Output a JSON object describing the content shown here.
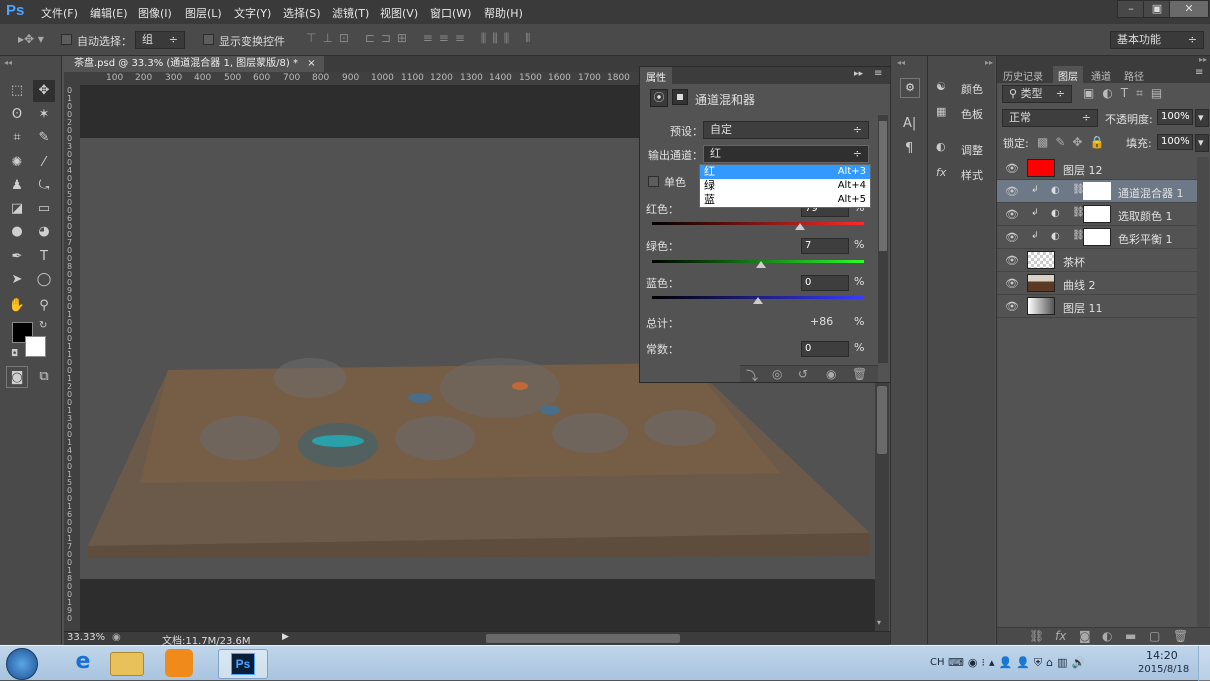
{
  "app": {
    "logo": "Ps"
  },
  "menu": [
    "文件(F)",
    "编辑(E)",
    "图像(I)",
    "图层(L)",
    "文字(Y)",
    "选择(S)",
    "滤镜(T)",
    "视图(V)",
    "窗口(W)",
    "帮助(H)"
  ],
  "window_buttons": {
    "minimize": "–",
    "restore": "▣",
    "close": "✕"
  },
  "options": {
    "auto_select_label": "自动选择：",
    "auto_select_value": "组",
    "show_transform_label": "显示变换控件",
    "workspace": "基本功能"
  },
  "document": {
    "tab_title": "茶盘.psd @ 33.3% (通道混合器 1, 图层蒙版/8) *",
    "close": "×",
    "zoom": "33.33%",
    "doc_size": "文档:11.7M/23.6M"
  },
  "ruler": {
    "top": [
      "100",
      "200",
      "300",
      "400",
      "500",
      "600",
      "700",
      "800",
      "900",
      "1000",
      "1100",
      "1200",
      "1300",
      "1400",
      "1500",
      "1600",
      "1700",
      "1800"
    ],
    "left": [
      "0",
      "1",
      "0",
      "0",
      "2",
      "0",
      "0",
      "3",
      "0",
      "0",
      "4",
      "0",
      "0",
      "5",
      "0",
      "0",
      "6",
      "0",
      "0",
      "7",
      "0",
      "0",
      "8",
      "0",
      "0",
      "9",
      "0",
      "0",
      "1",
      "0",
      "0",
      "0",
      "1",
      "1",
      "0",
      "0",
      "1",
      "2",
      "0",
      "0",
      "1",
      "3",
      "0",
      "0",
      "1",
      "4",
      "0",
      "0",
      "1",
      "5",
      "0",
      "0",
      "1",
      "6",
      "0",
      "0",
      "1",
      "7",
      "0",
      "0",
      "1",
      "8",
      "0",
      "0",
      "1",
      "9",
      "0"
    ]
  },
  "properties": {
    "tab": "属性",
    "title": "通道混和器",
    "preset_label": "预设：",
    "preset_value": "自定",
    "output_label": "输出通道：",
    "output_value": "红",
    "mono_label": "单色",
    "red_label": "红色：",
    "red_value": "79",
    "green_label": "绿色：",
    "green_value": "7",
    "blue_label": "蓝色：",
    "blue_value": "0",
    "total_label": "总计：",
    "total_value": "+86",
    "const_label": "常数：",
    "const_value": "0",
    "pct": "%",
    "dropdown": [
      {
        "label": "红",
        "shortcut": "Alt+3"
      },
      {
        "label": "绿",
        "shortcut": "Alt+4"
      },
      {
        "label": "蓝",
        "shortcut": "Alt+5"
      }
    ]
  },
  "dock": {
    "color": "颜色",
    "swatches": "色板",
    "adjust": "调整",
    "styles": "样式"
  },
  "layers_panel": {
    "tabs": [
      "历史记录",
      "图层",
      "通道",
      "路径"
    ],
    "filter_kind": "类型",
    "blend_mode": "正常",
    "opacity_label": "不透明度:",
    "opacity_value": "100%",
    "lock_label": "锁定:",
    "fill_label": "填充:",
    "fill_value": "100%",
    "layers": [
      {
        "name": "图层 12",
        "thumb": "#ff0000",
        "selected": false,
        "adjust": false
      },
      {
        "name": "通道混合器 1",
        "thumb": "#ffffff",
        "selected": true,
        "adjust": true
      },
      {
        "name": "选取颜色 1",
        "thumb": "#ffffff",
        "selected": false,
        "adjust": true
      },
      {
        "name": "色彩平衡 1",
        "thumb": "#ffffff",
        "selected": false,
        "adjust": true
      },
      {
        "name": "茶杯",
        "thumb": "checker",
        "selected": false,
        "adjust": false
      },
      {
        "name": "曲线 2",
        "thumb": "photo",
        "selected": false,
        "adjust": false
      },
      {
        "name": "图层 11",
        "thumb": "gradient",
        "selected": false,
        "adjust": false
      }
    ]
  },
  "taskbar": {
    "time": "14:20",
    "date": "2015/8/18",
    "ime": "CH",
    "ps": "Ps"
  }
}
